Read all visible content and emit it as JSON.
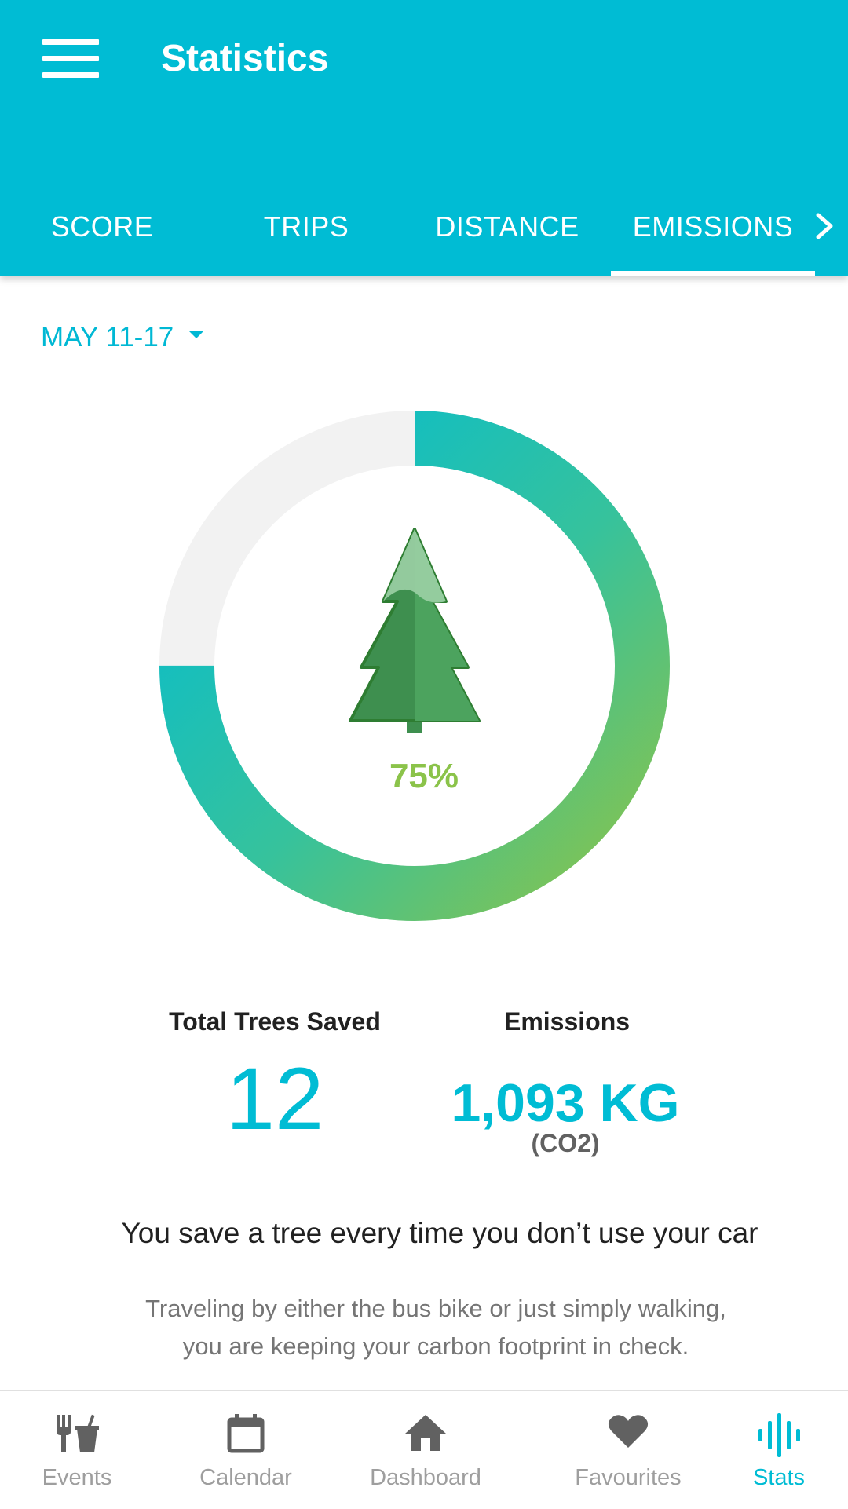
{
  "header": {
    "title": "Statistics",
    "tabs": [
      {
        "label": "SCORE"
      },
      {
        "label": "TRIPS"
      },
      {
        "label": "DISTANCE"
      },
      {
        "label": "EMISSIONS"
      }
    ],
    "active_tab": "EMISSIONS"
  },
  "date_range": {
    "label": "MAY 11-17"
  },
  "progress": {
    "percent_label": "75%",
    "value": 0.75,
    "icon": "tree-icon"
  },
  "stats": {
    "trees": {
      "label": "Total Trees Saved",
      "value": "12"
    },
    "emissions": {
      "label": "Emissions",
      "value": "1,093 KG",
      "unit": "(CO2)"
    }
  },
  "message": {
    "headline": "You save a tree every time you don’t use your car",
    "line1": "Traveling by either the bus bike or just simply walking,",
    "line2": "you are keeping your carbon footprint in check."
  },
  "bottom_nav": {
    "items": [
      {
        "label": "Events",
        "icon": "events-icon"
      },
      {
        "label": "Calendar",
        "icon": "calendar-icon"
      },
      {
        "label": "Dashboard",
        "icon": "home-icon"
      },
      {
        "label": "Favourites",
        "icon": "heart-icon"
      },
      {
        "label": "Stats",
        "icon": "stats-icon"
      }
    ],
    "active": "Stats"
  },
  "colors": {
    "primary": "#00BCD4",
    "ring_start": "#00BCD4",
    "ring_end": "#8BC34A",
    "ring_track": "#F2F2F2",
    "tree": "#43A047"
  }
}
